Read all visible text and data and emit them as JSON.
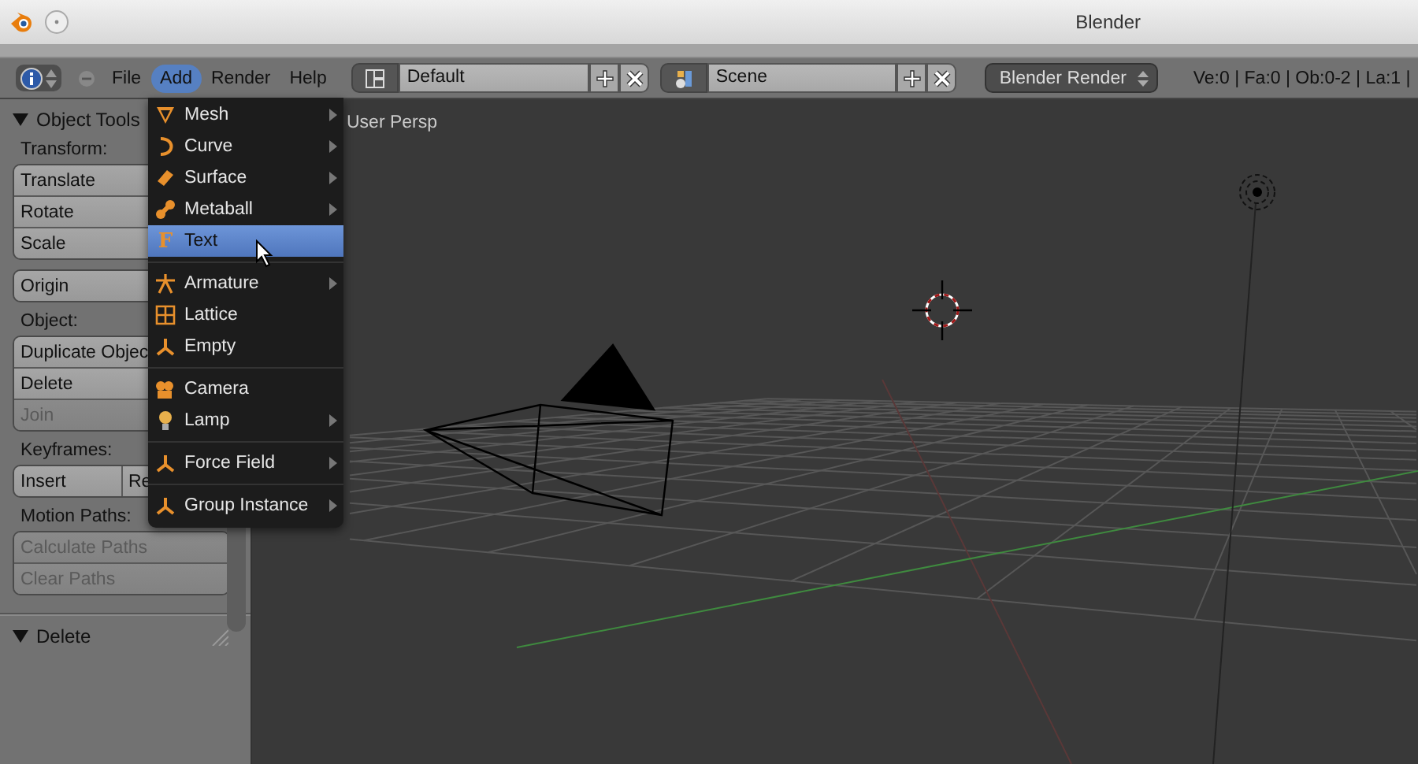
{
  "window": {
    "title": "Blender"
  },
  "header": {
    "menus": [
      {
        "label": "File",
        "selected": false
      },
      {
        "label": "Add",
        "selected": true
      },
      {
        "label": "Render",
        "selected": false
      },
      {
        "label": "Help",
        "selected": false
      }
    ],
    "layout": {
      "value": "Default"
    },
    "scene": {
      "value": "Scene"
    },
    "render_engine": {
      "value": "Blender Render"
    },
    "stats": "Ve:0 | Fa:0 | Ob:0-2 | La:1 |"
  },
  "tool_panel": {
    "panels": [
      {
        "title": "Object Tools",
        "expanded": true,
        "sections": [
          {
            "label": "Transform:",
            "groups": [
              [
                [
                  {
                    "label": "Translate",
                    "disabled": false
                  }
                ],
                [
                  {
                    "label": "Rotate",
                    "disabled": false
                  }
                ],
                [
                  {
                    "label": "Scale",
                    "disabled": false
                  }
                ]
              ],
              [
                [
                  {
                    "label": "Origin",
                    "disabled": false
                  }
                ]
              ]
            ]
          },
          {
            "label": "Object:",
            "groups": [
              [
                [
                  {
                    "label": "Duplicate Objec",
                    "disabled": false
                  }
                ],
                [
                  {
                    "label": "Delete",
                    "disabled": false
                  }
                ],
                [
                  {
                    "label": "Join",
                    "disabled": true
                  }
                ]
              ]
            ]
          },
          {
            "label": "Keyframes:",
            "groups": [
              [
                [
                  {
                    "label": "Insert",
                    "disabled": false
                  },
                  {
                    "label": "Re",
                    "disabled": false
                  }
                ]
              ]
            ]
          },
          {
            "label": "Motion Paths:",
            "groups": [
              [
                [
                  {
                    "label": "Calculate Paths",
                    "disabled": true
                  }
                ],
                [
                  {
                    "label": "Clear Paths",
                    "disabled": true
                  }
                ]
              ]
            ]
          }
        ]
      },
      {
        "title": "Delete",
        "expanded": true
      }
    ]
  },
  "viewport": {
    "view_label": "User Persp"
  },
  "add_menu": {
    "groups": [
      [
        {
          "label": "Mesh",
          "submenu": true,
          "selected": false
        },
        {
          "label": "Curve",
          "submenu": true,
          "selected": false
        },
        {
          "label": "Surface",
          "submenu": true,
          "selected": false
        },
        {
          "label": "Metaball",
          "submenu": true,
          "selected": false
        },
        {
          "label": "Text",
          "submenu": false,
          "selected": true,
          "glyph": "F"
        }
      ],
      [
        {
          "label": "Armature",
          "submenu": true,
          "selected": false
        },
        {
          "label": "Lattice",
          "submenu": false,
          "selected": false
        },
        {
          "label": "Empty",
          "submenu": false,
          "selected": false
        }
      ],
      [
        {
          "label": "Camera",
          "submenu": false,
          "selected": false
        },
        {
          "label": "Lamp",
          "submenu": true,
          "selected": false
        }
      ],
      [
        {
          "label": "Force Field",
          "submenu": true,
          "selected": false
        }
      ],
      [
        {
          "label": "Group Instance",
          "submenu": true,
          "selected": false
        }
      ]
    ]
  }
}
